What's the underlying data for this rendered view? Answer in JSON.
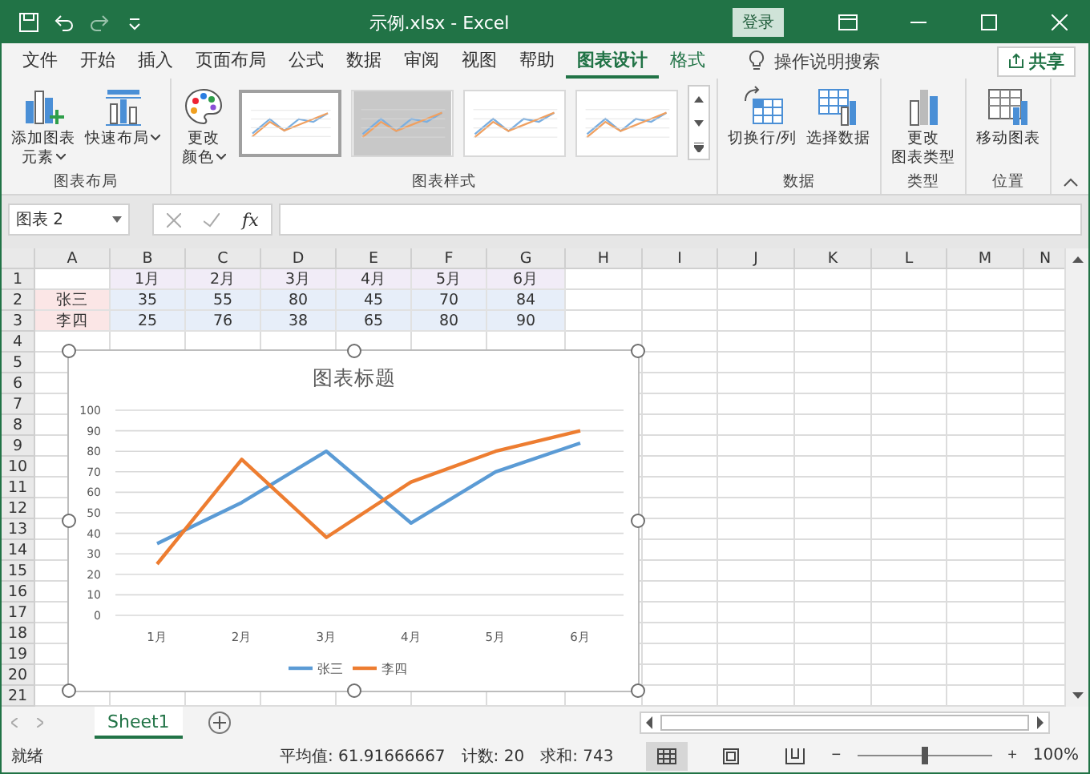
{
  "title_bar": {
    "title": "示例.xlsx  -  Excel",
    "login": "登录"
  },
  "menu_tabs": [
    {
      "label": "文件",
      "selected": false,
      "contextual": false
    },
    {
      "label": "开始",
      "selected": false,
      "contextual": false
    },
    {
      "label": "插入",
      "selected": false,
      "contextual": false
    },
    {
      "label": "页面布局",
      "selected": false,
      "contextual": false
    },
    {
      "label": "公式",
      "selected": false,
      "contextual": false
    },
    {
      "label": "数据",
      "selected": false,
      "contextual": false
    },
    {
      "label": "审阅",
      "selected": false,
      "contextual": false
    },
    {
      "label": "视图",
      "selected": false,
      "contextual": false
    },
    {
      "label": "帮助",
      "selected": false,
      "contextual": false
    },
    {
      "label": "图表设计",
      "selected": true,
      "contextual": true
    },
    {
      "label": "格式",
      "selected": false,
      "contextual": true
    }
  ],
  "tell_me": "操作说明搜索",
  "share": "共享",
  "ribbon_groups": [
    {
      "label": "图表布局",
      "buttons": [
        {
          "lines": [
            "添加图表",
            "元素"
          ],
          "dropdown": true
        },
        {
          "lines": [
            "快速布局"
          ],
          "dropdown": true
        }
      ]
    },
    {
      "label": "图表样式",
      "buttons": [
        {
          "lines": [
            "更改",
            "颜色"
          ],
          "dropdown": true
        }
      ],
      "styles": [
        {
          "selected": true
        },
        {
          "selected": false
        },
        {
          "selected": false
        },
        {
          "selected": false
        }
      ]
    },
    {
      "label": "数据",
      "buttons": [
        {
          "lines": [
            "切换行/列"
          ],
          "dropdown": false
        },
        {
          "lines": [
            "选择数据"
          ],
          "dropdown": false
        }
      ]
    },
    {
      "label": "类型",
      "buttons": [
        {
          "lines": [
            "更改",
            "图表类型"
          ],
          "dropdown": false
        }
      ]
    },
    {
      "label": "位置",
      "buttons": [
        {
          "lines": [
            "移动图表"
          ],
          "dropdown": false
        }
      ]
    }
  ],
  "formula_bar": {
    "name_box": "图表 2",
    "function_label": "fx"
  },
  "sheet": {
    "columns": [
      "A",
      "B",
      "C",
      "D",
      "E",
      "F",
      "G",
      "H",
      "I",
      "J",
      "K",
      "L",
      "M",
      "N"
    ],
    "rows": [
      {
        "header": "1",
        "color": "#f1ecf7",
        "cells": [
          "1月",
          "2月",
          "3月",
          "4月",
          "5月",
          "6月"
        ]
      },
      {
        "header": "2",
        "label": {
          "text": "张三",
          "color": "#fbe6e6"
        },
        "color": "#e7eef9",
        "cells": [
          "35",
          "55",
          "80",
          "45",
          "70",
          "84"
        ]
      },
      {
        "header": "3",
        "label": {
          "text": "李四",
          "color": "#fbe6e6"
        },
        "color": "#e7eef9",
        "cells": [
          "25",
          "76",
          "38",
          "65",
          "80",
          "90"
        ]
      },
      {
        "header": "4"
      },
      {
        "header": "5"
      },
      {
        "header": "6"
      },
      {
        "header": "7"
      },
      {
        "header": "8"
      },
      {
        "header": "9"
      },
      {
        "header": "10"
      },
      {
        "header": "11"
      },
      {
        "header": "12"
      },
      {
        "header": "13"
      },
      {
        "header": "14"
      },
      {
        "header": "15"
      },
      {
        "header": "16"
      },
      {
        "header": "17"
      },
      {
        "header": "18"
      },
      {
        "header": "19"
      },
      {
        "header": "20"
      },
      {
        "header": "21"
      }
    ]
  },
  "chart": {
    "selected": true,
    "chart_data": {
      "type": "line",
      "title": "图表标题",
      "categories": [
        "1月",
        "2月",
        "3月",
        "4月",
        "5月",
        "6月"
      ],
      "series": [
        {
          "name": "张三",
          "color": "#5b9bd5",
          "values": [
            35,
            55,
            80,
            45,
            70,
            84
          ]
        },
        {
          "name": "李四",
          "color": "#ed7d31",
          "values": [
            25,
            76,
            38,
            65,
            80,
            90
          ]
        }
      ],
      "ylim": [
        0,
        100
      ],
      "yticks": [
        0,
        10,
        20,
        30,
        40,
        50,
        60,
        70,
        80,
        90,
        100
      ],
      "grid": true,
      "legend": "bottom"
    }
  },
  "sheet_tabs": [
    {
      "label": "Sheet1",
      "selected": true
    }
  ],
  "status_bar": {
    "status": "就绪",
    "stats": [
      "平均值: 61.91666667",
      "计数: 20",
      "求和: 743"
    ],
    "views": [
      {
        "selected": true
      },
      {
        "selected": false
      },
      {
        "selected": false
      }
    ],
    "zoom": {
      "out": "−",
      "in": "+",
      "level": 0.5,
      "reading": "100%"
    }
  }
}
